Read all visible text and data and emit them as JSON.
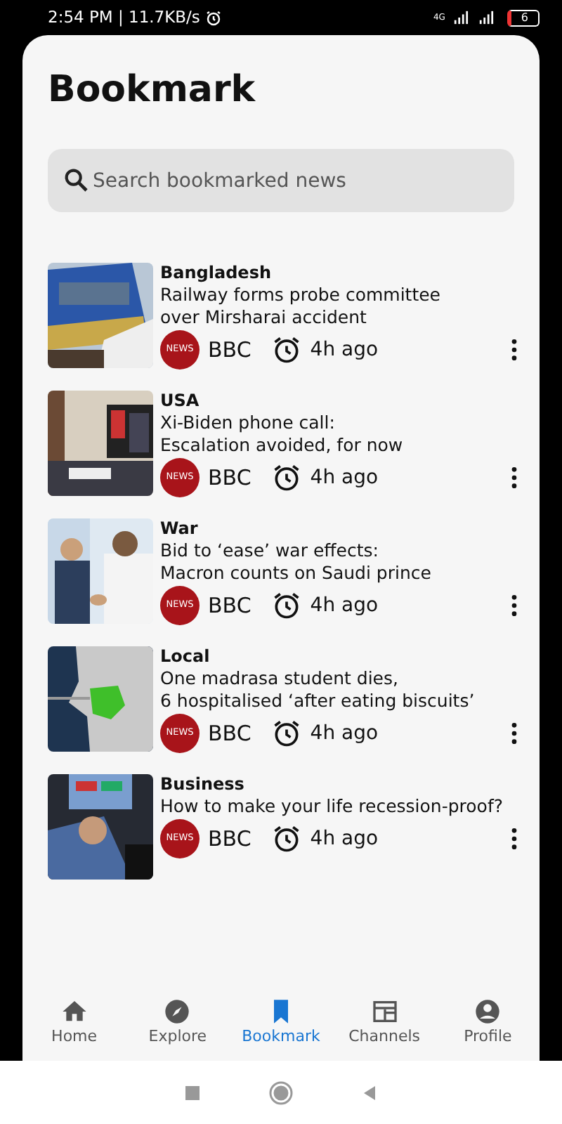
{
  "status_bar": {
    "time_speed": "2:54 PM | 11.7KB/s",
    "network": "4G",
    "battery": "6"
  },
  "title": "Bookmark",
  "search": {
    "placeholder": "Search bookmarked news"
  },
  "articles": [
    {
      "category": "Bangladesh",
      "headline": "Railway forms probe committee\nover Mirsharai accident",
      "logo_text": "NEWS",
      "source": "BBC",
      "time": "4h ago"
    },
    {
      "category": "USA",
      "headline": "Xi-Biden phone call:\nEscalation avoided, for now",
      "logo_text": "NEWS",
      "source": "BBC",
      "time": "4h ago"
    },
    {
      "category": "War",
      "headline": "Bid to ‘ease’ war effects:\nMacron counts on Saudi prince",
      "logo_text": "NEWS",
      "source": "BBC",
      "time": "4h ago"
    },
    {
      "category": "Local",
      "headline": "One madrasa student dies,\n6 hospitalised ‘after eating biscuits’",
      "logo_text": "NEWS",
      "source": "BBC",
      "time": "4h ago"
    },
    {
      "category": "Business",
      "headline": "How to make your life recession-proof?",
      "logo_text": "NEWS",
      "source": "BBC",
      "time": "4h ago"
    }
  ],
  "nav": [
    {
      "label": "Home",
      "selected": false
    },
    {
      "label": "Explore",
      "selected": false
    },
    {
      "label": "Bookmark",
      "selected": true
    },
    {
      "label": "Channels",
      "selected": false
    },
    {
      "label": "Profile",
      "selected": false
    }
  ]
}
